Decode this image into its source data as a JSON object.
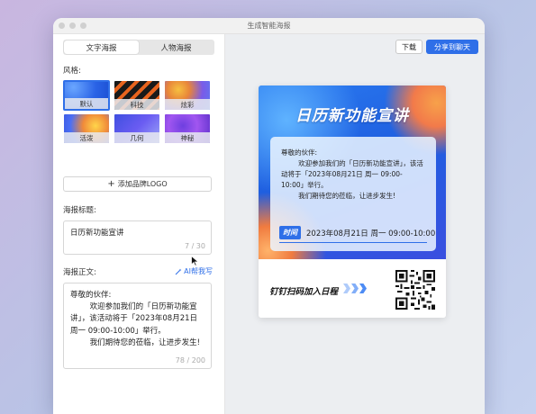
{
  "window": {
    "title": "生成智能海报"
  },
  "tabs": [
    {
      "label": "文字海报",
      "active": true
    },
    {
      "label": "人物海报",
      "active": false
    }
  ],
  "style_section": {
    "label": "风格:",
    "options": [
      {
        "label": "默认",
        "selected": true
      },
      {
        "label": "科技",
        "selected": false
      },
      {
        "label": "炫彩",
        "selected": false
      },
      {
        "label": "活泼",
        "selected": false
      },
      {
        "label": "几何",
        "selected": false
      },
      {
        "label": "神秘",
        "selected": false
      }
    ]
  },
  "add_logo_label": "添加品牌LOGO",
  "poster_title_field": {
    "label": "海报标题:",
    "value": "日历新功能宣讲",
    "count": "7 / 30"
  },
  "poster_body_field": {
    "label": "海报正文:",
    "ai_label": "AI帮我写",
    "value": "尊敬的伙伴:\n        欢迎参加我们的「日历新功能宣讲」，该活动将于「2023年08月21日 周一 09:00-10:00」举行。\n        我们期待您的莅临，让进步发生!",
    "count": "78 / 200"
  },
  "toolbar": {
    "download_label": "下载",
    "share_label": "分享到聊天"
  },
  "poster": {
    "title": "日历新功能宣讲",
    "body": "尊敬的伙伴:\n        欢迎参加我们的「日历新功能宣讲」，该活动将于「2023年08月21日 周一 09:00-10:00」举行。\n        我们期待您的莅临，让进步发生!",
    "time_tag": "时间",
    "time_value": "2023年08月21日 周一 09:00-10:00",
    "scan_text": "钉钉扫码加入日程"
  },
  "colors": {
    "accent": "#2f6fe8"
  }
}
